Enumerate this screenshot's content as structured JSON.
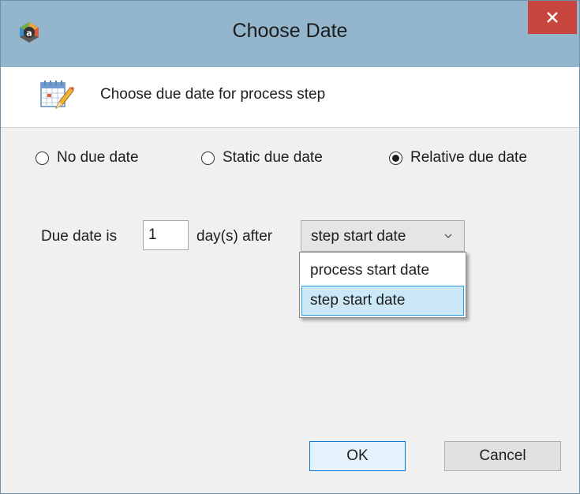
{
  "window": {
    "title": "Choose Date",
    "app_icon": "app-logo-icon",
    "close_icon": "close-icon"
  },
  "header": {
    "icon": "calendar-edit-icon",
    "text": "Choose due date for process step"
  },
  "due_type": {
    "options": [
      {
        "label": "No due date",
        "checked": false
      },
      {
        "label": "Static due date",
        "checked": false
      },
      {
        "label": "Relative due date",
        "checked": true
      }
    ]
  },
  "relative": {
    "prefix_label": "Due date is",
    "days_value": "1",
    "suffix_label": "day(s) after",
    "reference_selected": "step start date",
    "reference_options": [
      "process start date",
      "step start date"
    ]
  },
  "buttons": {
    "ok_label": "OK",
    "cancel_label": "Cancel"
  },
  "colors": {
    "titlebar": "#94b6cc",
    "close_button": "#c7453c",
    "selection": "#cce8f6",
    "accent_border": "#0b78d7"
  }
}
